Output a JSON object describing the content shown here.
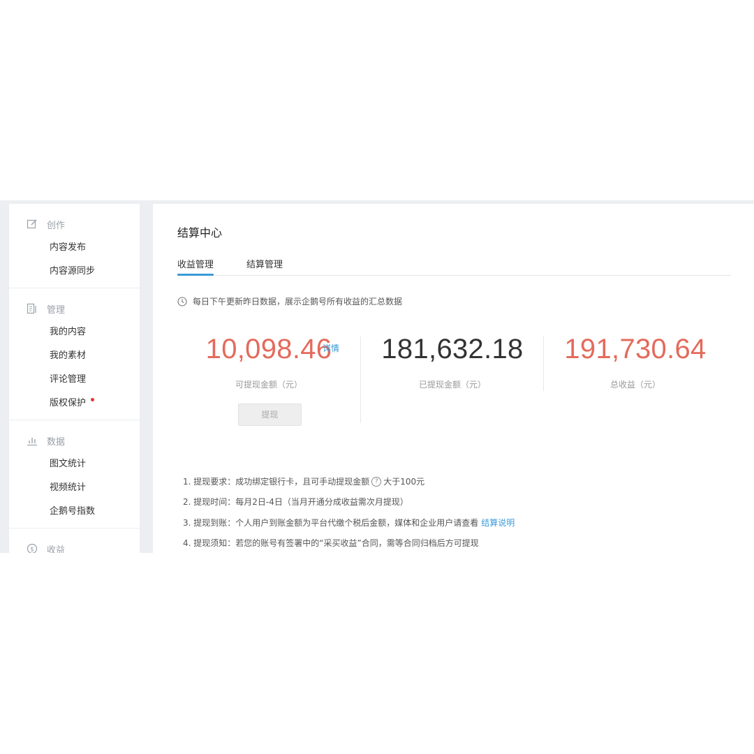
{
  "sidebar": {
    "groups": [
      {
        "label": "创作",
        "icon": "edit-icon",
        "items": [
          {
            "label": "内容发布"
          },
          {
            "label": "内容源同步"
          }
        ]
      },
      {
        "label": "管理",
        "icon": "document-icon",
        "items": [
          {
            "label": "我的内容"
          },
          {
            "label": "我的素材"
          },
          {
            "label": "评论管理"
          },
          {
            "label": "版权保护"
          }
        ]
      },
      {
        "label": "数据",
        "icon": "bar-chart-icon",
        "items": [
          {
            "label": "图文统计"
          },
          {
            "label": "视频统计"
          },
          {
            "label": "企鹅号指数"
          }
        ]
      },
      {
        "label": "收益",
        "icon": "dollar-icon",
        "items": []
      }
    ]
  },
  "main": {
    "title": "结算中心",
    "tabs": [
      {
        "label": "收益管理",
        "active": true
      },
      {
        "label": "结算管理",
        "active": false
      }
    ],
    "notice": "每日下午更新昨日数据，展示企鹅号所有收益的汇总数据",
    "stats": [
      {
        "value": "10,098.46",
        "caption": "可提现金额（元）",
        "detail": "详情",
        "color": "#e46a5c"
      },
      {
        "value": "181,632.18",
        "caption": "已提现金额（元）",
        "color": "#333333"
      },
      {
        "value": "191,730.64",
        "caption": "总收益（元）",
        "color": "#e46a5c"
      }
    ],
    "withdraw_label": "提现",
    "rules": {
      "r1_pre": "1. 提现要求：成功绑定银行卡，且可手动提现金额",
      "r1_post": "大于100元",
      "r2": "2. 提现时间：每月2日-4日（当月开通分成收益需次月提现）",
      "r3_pre": "3. 提现到账：个人用户到账金额为平台代缴个税后金额，媒体和企业用户请查看",
      "r3_link": "结算说明",
      "r4": "4. 提现须知：若您的账号有签署中的“采买收益”合同，需等合同归档后方可提现"
    }
  },
  "colors": {
    "accent": "#3a9bd8",
    "highlight": "#e46a5c",
    "badge": "#e8342a"
  }
}
